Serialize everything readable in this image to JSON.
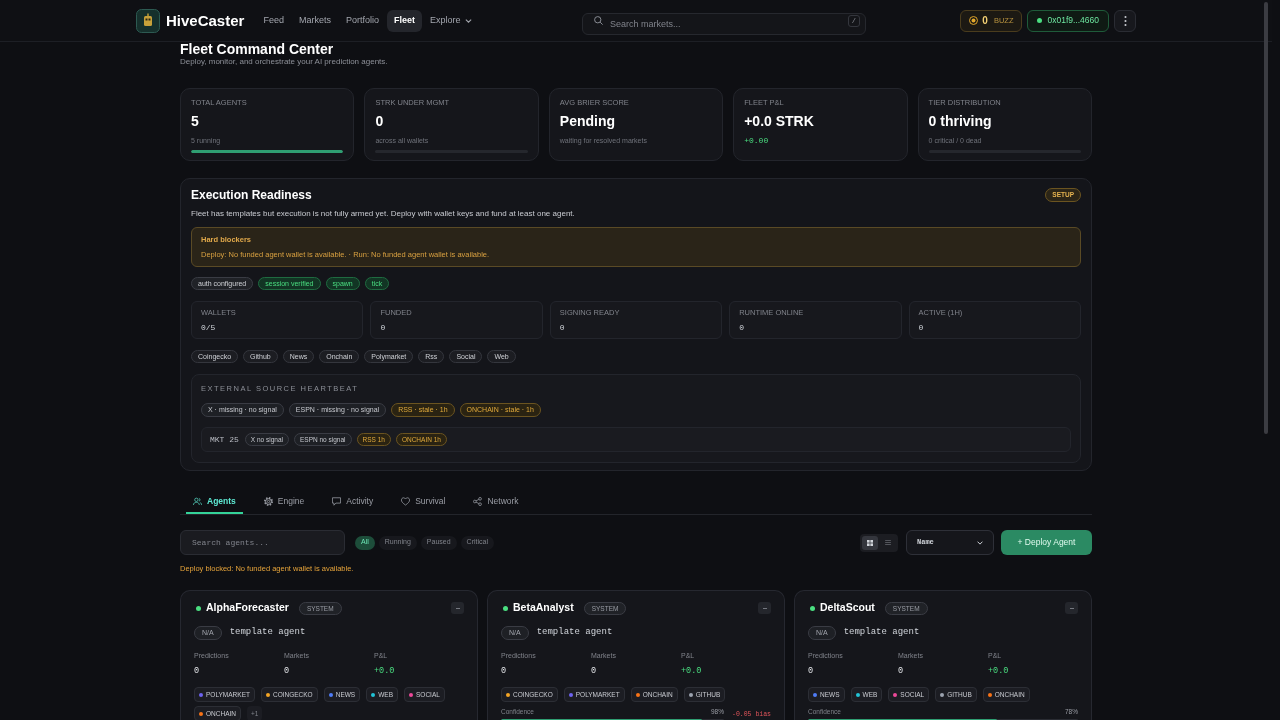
{
  "nav": {
    "brand": "HiveCaster",
    "links": [
      {
        "label": "Feed",
        "selected": false,
        "kind": "link"
      },
      {
        "label": "Markets",
        "selected": false,
        "kind": "link"
      },
      {
        "label": "Portfolio",
        "selected": false,
        "kind": "link"
      },
      {
        "label": "Fleet",
        "selected": true,
        "kind": "link"
      },
      {
        "label": "Explore",
        "selected": false,
        "kind": "dropdown"
      }
    ],
    "search": {
      "placeholder": "Search markets...",
      "shortcut": "/"
    },
    "buzz": {
      "amount": "0",
      "unit": "BUZZ"
    },
    "wallet": {
      "address": "0x01f9...4660"
    }
  },
  "header": {
    "title": "Fleet Command Center",
    "subtitle": "Deploy, monitor, and orchestrate your AI prediction agents."
  },
  "stats": [
    {
      "label": "TOTAL AGENTS",
      "value": "5",
      "note": "5 running",
      "kind": "bar",
      "level": 1
    },
    {
      "label": "STRK UNDER MGMT",
      "value": "0",
      "note": "across all wallets",
      "kind": "bar",
      "level": 0
    },
    {
      "label": "AVG BRIER SCORE",
      "value": "Pending",
      "note": "waiting for resolved markets",
      "kind": "plain"
    },
    {
      "label": "FLEET P&L",
      "value": "+0.0 STRK",
      "note": "+0.00",
      "kind": "delta"
    },
    {
      "label": "TIER DISTRIBUTION",
      "value": "0 thriving",
      "note": "0 critical / 0 dead",
      "kind": "bar",
      "level": 0
    }
  ],
  "readiness": {
    "title": "Execution Readiness",
    "badge": "SETUP",
    "description": "Fleet has templates but execution is not fully armed yet. Deploy with wallet keys and fund at least one agent.",
    "blockers": {
      "title": "Hard blockers",
      "text": "Deploy: No funded agent wallet is available. · Run: No funded agent wallet is available."
    },
    "checks": [
      {
        "label": "auth configured",
        "ok": false
      },
      {
        "label": "session verified",
        "ok": true
      },
      {
        "label": "spawn",
        "ok": true
      },
      {
        "label": "tick",
        "ok": true
      }
    ],
    "metrics": [
      {
        "label": "WALLETS",
        "value": "0/5"
      },
      {
        "label": "FUNDED",
        "value": "0"
      },
      {
        "label": "SIGNING READY",
        "value": "0"
      },
      {
        "label": "RUNTIME ONLINE",
        "value": "0"
      },
      {
        "label": "ACTIVE (1H)",
        "value": "0"
      }
    ],
    "sources": [
      "Coingecko",
      "Github",
      "News",
      "Onchain",
      "Polymarket",
      "Rss",
      "Social",
      "Web"
    ],
    "heartbeat": {
      "title": "EXTERNAL SOURCE HEARTBEAT",
      "signals": [
        {
          "label": "X · missing · no signal",
          "stale": false
        },
        {
          "label": "ESPN · missing · no signal",
          "stale": false
        },
        {
          "label": "RSS · stale · 1h",
          "stale": true
        },
        {
          "label": "ONCHAIN · stale · 1h",
          "stale": true
        }
      ],
      "market": {
        "label": "MKT 25",
        "signals": [
          {
            "label": "X no signal",
            "stale": false
          },
          {
            "label": "ESPN no signal",
            "stale": false
          },
          {
            "label": "RSS 1h",
            "stale": true
          },
          {
            "label": "ONCHAIN 1h",
            "stale": true
          }
        ]
      }
    }
  },
  "tabs": [
    {
      "label": "Agents",
      "selected": true
    },
    {
      "label": "Engine",
      "selected": false
    },
    {
      "label": "Activity",
      "selected": false
    },
    {
      "label": "Survival",
      "selected": false
    },
    {
      "label": "Network",
      "selected": false
    }
  ],
  "toolbar": {
    "search": {
      "placeholder": "Search agents..."
    },
    "filters": [
      {
        "label": "All",
        "selected": true
      },
      {
        "label": "Running",
        "selected": false
      },
      {
        "label": "Paused",
        "selected": false
      },
      {
        "label": "Critical",
        "selected": false
      }
    ],
    "view_modes": [
      {
        "kind": "grid",
        "selected": true
      },
      {
        "kind": "list",
        "selected": false
      }
    ],
    "sort": {
      "value": "Name"
    },
    "deploy_button": "+ Deploy Agent",
    "warning": "Deploy blocked: No funded agent wallet is available."
  },
  "agents": [
    {
      "name": "AlphaForecaster",
      "running": true,
      "badge": "SYSTEM",
      "tier": "N/A",
      "description": "template agent",
      "stats": [
        {
          "label": "Predictions",
          "value": "0",
          "kind": "count"
        },
        {
          "label": "Markets",
          "value": "0",
          "kind": "count"
        },
        {
          "label": "P&L",
          "value": "+0.0",
          "kind": "pnl"
        }
      ],
      "sources": [
        {
          "label": "POLYMARKET",
          "color": "#6d63f0"
        },
        {
          "label": "COINGECKO",
          "color": "#f5a524"
        },
        {
          "label": "NEWS",
          "color": "#4f7cf7"
        },
        {
          "label": "WEB",
          "color": "#22c3d6"
        },
        {
          "label": "SOCIAL",
          "color": "#ec4899"
        },
        {
          "label": "ONCHAIN",
          "color": "#f97316"
        }
      ],
      "more": "+1"
    },
    {
      "name": "BetaAnalyst",
      "running": true,
      "badge": "SYSTEM",
      "tier": "N/A",
      "description": "template agent",
      "stats": [
        {
          "label": "Predictions",
          "value": "0",
          "kind": "count"
        },
        {
          "label": "Markets",
          "value": "0",
          "kind": "count"
        },
        {
          "label": "P&L",
          "value": "+0.0",
          "kind": "pnl"
        }
      ],
      "sources": [
        {
          "label": "COINGECKO",
          "color": "#f5a524"
        },
        {
          "label": "POLYMARKET",
          "color": "#6d63f0"
        },
        {
          "label": "ONCHAIN",
          "color": "#f97316"
        },
        {
          "label": "GITHUB",
          "color": "#9ca3af"
        }
      ],
      "confidence": {
        "label": "Confidence",
        "reading": "98%",
        "bias": "-0.05 bias",
        "level": 0.9
      }
    },
    {
      "name": "DeltaScout",
      "running": true,
      "badge": "SYSTEM",
      "tier": "N/A",
      "description": "template agent",
      "stats": [
        {
          "label": "Predictions",
          "value": "0",
          "kind": "count"
        },
        {
          "label": "Markets",
          "value": "0",
          "kind": "count"
        },
        {
          "label": "P&L",
          "value": "+0.0",
          "kind": "pnl"
        }
      ],
      "sources": [
        {
          "label": "NEWS",
          "color": "#4f7cf7"
        },
        {
          "label": "WEB",
          "color": "#22c3d6"
        },
        {
          "label": "SOCIAL",
          "color": "#ec4899"
        },
        {
          "label": "GITHUB",
          "color": "#9ca3af"
        },
        {
          "label": "ONCHAIN",
          "color": "#f97316"
        }
      ],
      "confidence": {
        "label": "Confidence",
        "reading": "78%",
        "level": 0.7
      }
    }
  ]
}
